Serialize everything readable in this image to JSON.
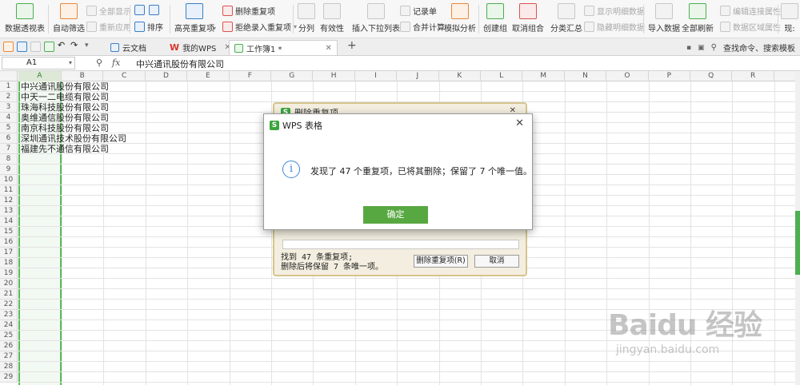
{
  "ribbon": {
    "pivot": "数据透视表",
    "autofilter": "自动筛选",
    "show_all": "全部显示",
    "reapply": "重新应用",
    "sort": "排序",
    "highlight_dup": "高亮重复项",
    "remove_dup": "删除重复项",
    "reject_dup": "拒绝录入重复项",
    "split": "分列",
    "validity": "有效性",
    "insert_dropdown": "插入下拉列表",
    "form": "记录单",
    "consolidate": "合并计算",
    "simulate": "模拟分析",
    "group": "创建组",
    "ungroup": "取消组合",
    "subtotal": "分类汇总",
    "show_detail": "显示明细数据",
    "hide_detail": "隐藏明细数据",
    "import_data": "导入数据",
    "refresh_all": "全部刷新",
    "edit_conn": "编辑连接属性",
    "range_prop": "数据区域属性",
    "more": "现:"
  },
  "tabs": {
    "cloud": "云文档",
    "my_wps": "我的WPS",
    "workbook": "工作簿1 *",
    "search": "查找命令、搜索模板"
  },
  "formula_bar": {
    "cell_ref": "A1",
    "fx": "fx",
    "content": "中兴通讯股份有限公司"
  },
  "columns": [
    "A",
    "B",
    "C",
    "D",
    "E",
    "F",
    "G",
    "H",
    "I",
    "J",
    "K",
    "L",
    "M",
    "N",
    "O",
    "P",
    "Q",
    "R"
  ],
  "rows": [
    "1",
    "2",
    "3",
    "4",
    "5",
    "6",
    "7",
    "8",
    "9",
    "10",
    "11",
    "12",
    "13",
    "14",
    "15",
    "16",
    "17",
    "18",
    "19",
    "20",
    "21",
    "22",
    "23",
    "24",
    "25",
    "26",
    "27",
    "28",
    "29"
  ],
  "cells": [
    "中兴通讯股份有限公司",
    "中天一二电缆有限公司",
    "珠海科技股份有限公司",
    "奥维通信股份有限公司",
    "南京科技股份有限公司",
    "深圳通讯技术股份有限公司",
    "福建先不通信有限公司"
  ],
  "bg_dialog": {
    "title": "删除重复项",
    "found": "找到 47 条重复项;",
    "keep": "删除后将保留 7 条唯一项。",
    "delete_btn": "删除重复项(R)",
    "cancel_btn": "取消"
  },
  "dialog": {
    "title": "WPS 表格",
    "logo": "S",
    "message": "发现了 47 个重复项，已将其删除；保留了 7 个唯一值。",
    "ok": "确定",
    "info_icon": "i"
  },
  "watermark": {
    "big": "Baidu 经验",
    "small": "jingyan.baidu.com"
  }
}
